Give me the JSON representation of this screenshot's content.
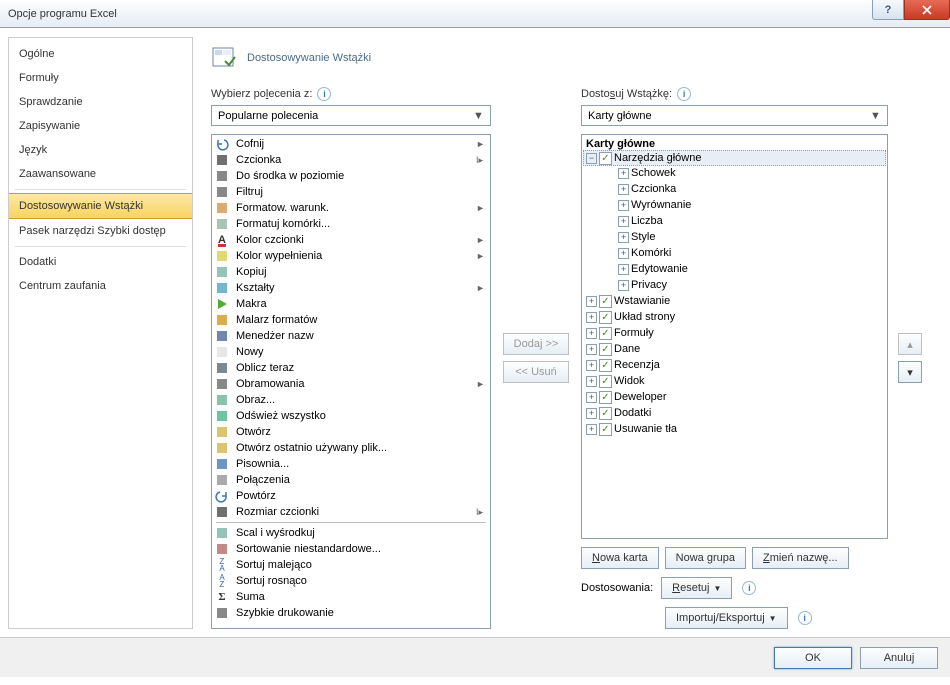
{
  "title": "Opcje programu Excel",
  "sidebar": {
    "items": [
      {
        "label": "Ogólne"
      },
      {
        "label": "Formuły"
      },
      {
        "label": "Sprawdzanie"
      },
      {
        "label": "Zapisywanie"
      },
      {
        "label": "Język"
      },
      {
        "label": "Zaawansowane"
      },
      {
        "label": "Dostosowywanie Wstążki",
        "selected": true
      },
      {
        "label": "Pasek narzędzi Szybki dostęp"
      },
      {
        "label": "Dodatki"
      },
      {
        "label": "Centrum zaufania"
      }
    ]
  },
  "header": "Dostosowywanie Wstążki",
  "left": {
    "label_pre": "Wybierz po",
    "label_u": "l",
    "label_post": "ecenia z:",
    "combo": "Popularne polecenia",
    "commands": [
      {
        "icon": "undo",
        "label": "Cofnij",
        "sub": "►",
        "subr": "▸"
      },
      {
        "icon": "font",
        "label": "Czcionka",
        "sub": "I▸"
      },
      {
        "icon": "center",
        "label": "Do środka w poziomie"
      },
      {
        "icon": "filter",
        "label": "Filtruj"
      },
      {
        "icon": "cond",
        "label": "Formatow. warunk.",
        "sub": "►"
      },
      {
        "icon": "format",
        "label": "Formatuj komórki..."
      },
      {
        "icon": "fontcolor",
        "label": "Kolor czcionki",
        "sub": "►"
      },
      {
        "icon": "fill",
        "label": "Kolor wypełnienia",
        "sub": "►"
      },
      {
        "icon": "copy",
        "label": "Kopiuj"
      },
      {
        "icon": "shapes",
        "label": "Kształty",
        "sub": "►"
      },
      {
        "icon": "play",
        "label": "Makra"
      },
      {
        "icon": "brush",
        "label": "Malarz formatów"
      },
      {
        "icon": "namemgr",
        "label": "Menedżer nazw"
      },
      {
        "icon": "new",
        "label": "Nowy"
      },
      {
        "icon": "calc",
        "label": "Oblicz teraz"
      },
      {
        "icon": "borders",
        "label": "Obramowania",
        "sub": "►"
      },
      {
        "icon": "image",
        "label": "Obraz..."
      },
      {
        "icon": "refresh",
        "label": "Odśwież wszystko"
      },
      {
        "icon": "open",
        "label": "Otwórz"
      },
      {
        "icon": "recent",
        "label": "Otwórz ostatnio używany plik..."
      },
      {
        "icon": "spell",
        "label": "Pisownia..."
      },
      {
        "icon": "conn",
        "label": "Połączenia"
      },
      {
        "icon": "redo",
        "label": "Powtórz"
      },
      {
        "icon": "fontsize",
        "label": "Rozmiar czcionki",
        "sub": "I▸",
        "sep_after": true
      },
      {
        "icon": "merge",
        "label": "Scal i wyśrodkuj"
      },
      {
        "icon": "sort",
        "label": "Sortowanie niestandardowe..."
      },
      {
        "icon": "sortza",
        "label": "Sortuj malejąco"
      },
      {
        "icon": "sortaz",
        "label": "Sortuj rosnąco"
      },
      {
        "icon": "sum",
        "label": "Suma"
      },
      {
        "icon": "qprint",
        "label": "Szybkie drukowanie"
      }
    ]
  },
  "mid": {
    "add": "Dodaj >>",
    "remove": "<< Usuń"
  },
  "right": {
    "label_pre": "Dosto",
    "label_u": "s",
    "label_post": "uj Wstążkę:",
    "combo": "Karty główne",
    "tree_header": "Karty główne",
    "root": {
      "label": "Narzędzia główne",
      "selected": true,
      "children": [
        {
          "label": "Schowek"
        },
        {
          "label": "Czcionka"
        },
        {
          "label": "Wyrównanie"
        },
        {
          "label": "Liczba"
        },
        {
          "label": "Style"
        },
        {
          "label": "Komórki"
        },
        {
          "label": "Edytowanie"
        },
        {
          "label": "Privacy"
        }
      ]
    },
    "siblings": [
      {
        "label": "Wstawianie"
      },
      {
        "label": "Układ strony"
      },
      {
        "label": "Formuły"
      },
      {
        "label": "Dane"
      },
      {
        "label": "Recenzja"
      },
      {
        "label": "Widok"
      },
      {
        "label": "Deweloper"
      },
      {
        "label": "Dodatki"
      },
      {
        "label": "Usuwanie tła"
      }
    ],
    "buttons": {
      "new_tab": "Nowa karta",
      "new_group": "Nowa grupa",
      "rename": "Zmień nazwę..."
    },
    "customizations_label": "Dostosowania:",
    "reset": "Resetuj",
    "import_export": "Importuj/Eksportuj"
  },
  "footer": {
    "ok": "OK",
    "cancel": "Anuluj"
  }
}
